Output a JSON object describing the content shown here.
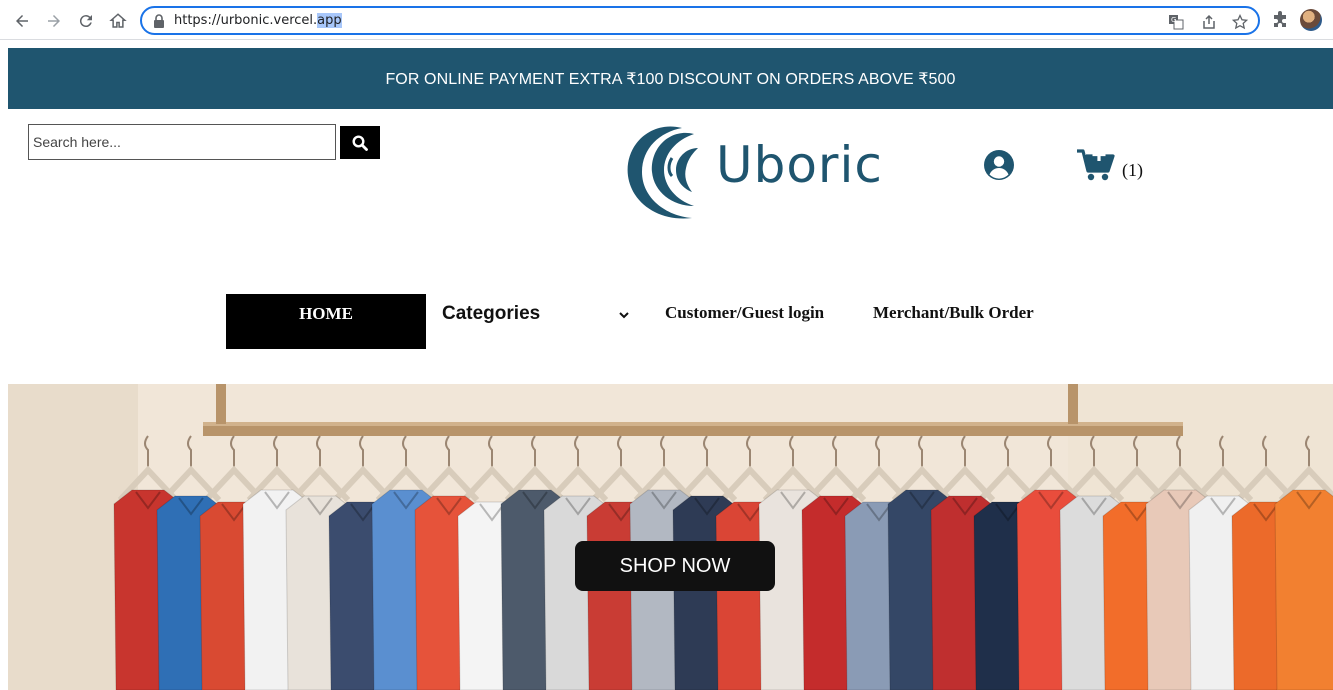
{
  "browser": {
    "url_prefix": "https://urbonic.vercel.",
    "url_highlight": "app",
    "icons": [
      "back-icon",
      "forward-icon",
      "reload-icon",
      "home-icon",
      "lock-icon",
      "translate-icon",
      "share-icon",
      "star-icon",
      "extensions-icon",
      "profile-avatar"
    ]
  },
  "banner": {
    "text": "FOR ONLINE PAYMENT EXTRA ₹100 DISCOUNT ON ORDERS ABOVE ₹500",
    "color": "#1f556f"
  },
  "header": {
    "search_placeholder": "Search here...",
    "logo_text": "Uboric",
    "brand_color": "#1f556f",
    "cart_count": "(1)"
  },
  "nav": {
    "home": "HOME",
    "categories": "Categories",
    "customer_login": "Customer/Guest login",
    "merchant": "Merchant/Bulk Order"
  },
  "hero": {
    "button": "SHOP NOW"
  }
}
